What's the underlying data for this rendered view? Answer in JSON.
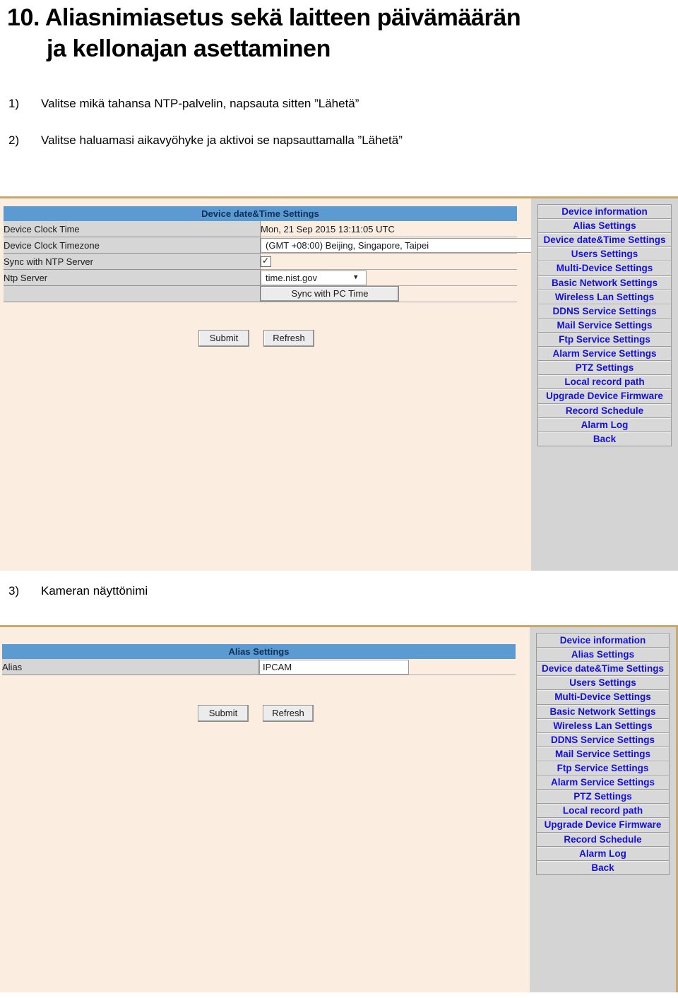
{
  "document": {
    "heading_line1": "10. Aliasnimiasetus sekä laitteen päivämäärän",
    "heading_line2": "ja kellonajan asettaminen",
    "steps": [
      {
        "num": "1)",
        "text": "Valitse mikä tahansa NTP-palvelin, napsauta sitten ”Lähetä”"
      },
      {
        "num": "2)",
        "text": "Valitse haluamasi aikavyöhyke ja aktivoi se napsauttamalla ”Lähetä”"
      },
      {
        "num": "3)",
        "text": "Kameran näyttönimi"
      }
    ]
  },
  "colors": {
    "title_bar": "#5b9bd1",
    "nav_link": "#1510d8",
    "page_background": "#fbeee0",
    "label_cell": "#d6d6d6",
    "nav_panel": "#d4d4d4",
    "screenshot_border": "#c9a96b"
  },
  "datetime_screenshot": {
    "panel_title": "Device date&Time Settings",
    "rows": [
      {
        "label": "Device Clock Time",
        "value": "Mon, 21 Sep 2015 13:11:05 UTC"
      },
      {
        "label": "Device Clock Timezone",
        "value": "(GMT +08:00) Beijing, Singapore, Taipei"
      },
      {
        "label": "Sync with NTP Server",
        "value": ""
      },
      {
        "label": "Ntp Server",
        "value": "time.nist.gov"
      },
      {
        "label": "",
        "value": "Sync with PC Time"
      }
    ],
    "timezone_selected": "(GMT +08:00) Beijing, Singapore, Taipei",
    "ntp_server_selected": "time.nist.gov",
    "sync_ntp_checked": true,
    "sync_pc_button": "Sync with PC Time",
    "submit_label": "Submit",
    "refresh_label": "Refresh"
  },
  "alias_screenshot": {
    "panel_title": "Alias Settings",
    "alias_label": "Alias",
    "alias_value": "IPCAM",
    "alias_placeholder": "",
    "submit_label": "Submit",
    "refresh_label": "Refresh"
  },
  "nav_menu": {
    "items": [
      "Device information",
      "Alias Settings",
      "Device date&Time\nSettings",
      "Users Settings",
      "Multi-Device Settings",
      "Basic Network Settings",
      "Wireless Lan Settings",
      "DDNS Service Settings",
      "Mail Service Settings",
      "Ftp Service Settings",
      "Alarm Service Settings",
      "PTZ Settings",
      "Local record path",
      "Upgrade Device\nFirmware",
      "Record Schedule",
      "Alarm Log",
      "Back"
    ]
  }
}
